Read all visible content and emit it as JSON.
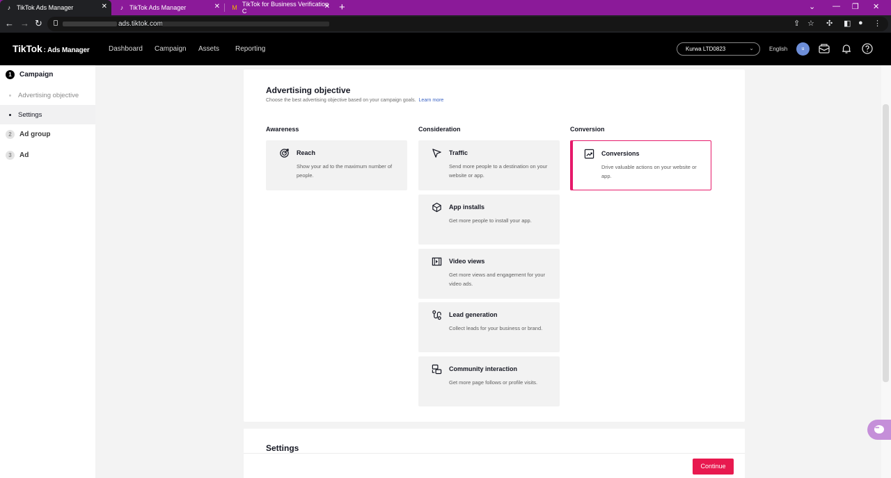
{
  "browser": {
    "tabs": [
      {
        "title": "TikTok Ads Manager",
        "active": true
      },
      {
        "title": "TikTok Ads Manager",
        "active": false
      },
      {
        "title": "TikTok for Business Verification C",
        "active": false
      }
    ],
    "url": "ads.tiktok.com",
    "accent_color": "#8b1a99"
  },
  "header": {
    "logo": "TikTok",
    "logo_sub": ": Ads Manager",
    "nav": [
      "Dashboard",
      "Campaign",
      "Assets",
      "Reporting"
    ],
    "account": "Kurwa LTD0823",
    "language": "English",
    "avatar_initial": "u"
  },
  "sidebar": {
    "steps": [
      {
        "num": "1",
        "label": "Campaign",
        "active": true
      },
      {
        "num": "2",
        "label": "Ad group",
        "active": false
      },
      {
        "num": "3",
        "label": "Ad",
        "active": false
      }
    ],
    "sub_items": [
      {
        "label": "Advertising objective",
        "selected": false
      },
      {
        "label": "Settings",
        "selected": true
      }
    ]
  },
  "objective": {
    "title": "Advertising objective",
    "subtitle": "Choose the best advertising objective based on your campaign goals.",
    "learn_more": "Learn more",
    "columns": [
      {
        "heading": "Awareness",
        "items": [
          {
            "icon": "reach-target-icon",
            "title": "Reach",
            "desc": "Show your ad to the maximum number of people."
          }
        ]
      },
      {
        "heading": "Consideration",
        "items": [
          {
            "icon": "cursor-arrow-icon",
            "title": "Traffic",
            "desc": "Send more people to a destination on your website or app."
          },
          {
            "icon": "app-box-icon",
            "title": "App installs",
            "desc": "Get more people to install your app."
          },
          {
            "icon": "video-film-icon",
            "title": "Video views",
            "desc": "Get more views and engagement for your video ads."
          },
          {
            "icon": "lead-funnel-icon",
            "title": "Lead generation",
            "desc": "Collect leads for your business or brand."
          },
          {
            "icon": "community-chat-icon",
            "title": "Community interaction",
            "desc": "Get more page follows or profile visits."
          }
        ]
      },
      {
        "heading": "Conversion",
        "items": [
          {
            "icon": "conversion-chart-icon",
            "title": "Conversions",
            "desc": "Drive valuable actions on your website or app.",
            "selected": true
          }
        ]
      }
    ],
    "selected_color": "#e6196a"
  },
  "settings": {
    "title": "Settings"
  },
  "footer": {
    "continue_label": "Continue",
    "button_color": "#e8194f"
  }
}
